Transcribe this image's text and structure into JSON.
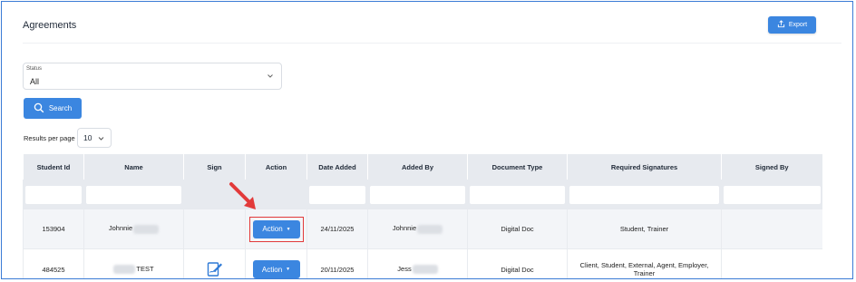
{
  "page": {
    "title": "Agreements"
  },
  "toolbar": {
    "export_label": "Export"
  },
  "filters": {
    "status_label": "Status",
    "status_value": "All",
    "search_label": "Search",
    "results_per_page_label": "Results per page",
    "results_per_page_value": "10"
  },
  "table": {
    "columns": [
      "Student Id",
      "Name",
      "Sign",
      "Action",
      "Date Added",
      "Added By",
      "Document Type",
      "Required Signatures",
      "Signed By"
    ],
    "rows": [
      {
        "student_id": "153904",
        "name": "Johnnie",
        "date_added": "24/11/2025",
        "added_by": "Johnnie",
        "document_type": "Digital Doc",
        "required_signatures": "Student, Trainer",
        "signed_by": "",
        "action_label": "Action"
      },
      {
        "student_id": "484525",
        "name": "TEST",
        "date_added": "20/11/2025",
        "added_by": "Jess",
        "document_type": "Digital Doc",
        "required_signatures": "Client, Student, External, Agent, Employer, Trainer",
        "signed_by": "",
        "action_label": "Action"
      }
    ]
  },
  "colors": {
    "accent": "#3b86e0",
    "highlight": "#e23a3a",
    "header_bg": "#e7eaef",
    "frame": "#3a7bd5"
  },
  "icons": [
    "upload-icon",
    "search-icon",
    "chevron-down-icon",
    "sign-document-icon",
    "caret-down-icon",
    "red-arrow-annotation"
  ]
}
